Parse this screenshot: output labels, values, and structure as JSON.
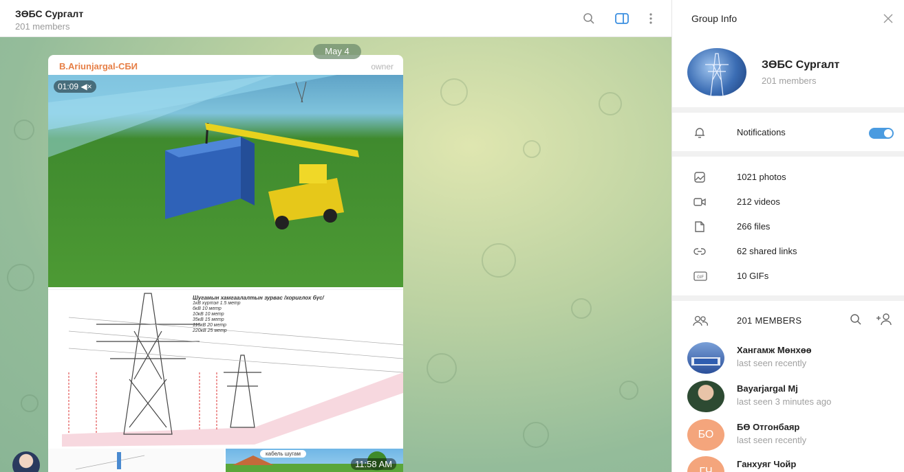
{
  "chat": {
    "title": "ЗӨБС Сургалт",
    "subtitle": "201 members",
    "date_label": "May 4",
    "message": {
      "author": "B.Ariunjargal-СБИ",
      "role": "owner",
      "video_duration": "01:09",
      "tower_title": "Шугамын хамгаалалтын зурвас /хориглох бүс/",
      "tower_lines": [
        "1кВ хүртэл 1.5 метр",
        "6кВ 10 метр",
        "10кВ 10 метр",
        "35кВ 15 метр",
        "110кВ 20 метр",
        "220кВ 25 метр"
      ],
      "diagram_label": "кабель шугам",
      "time": "11:58 AM"
    }
  },
  "panel": {
    "title": "Group Info",
    "group_name": "ЗӨБС Сургалт",
    "group_members": "201 members",
    "notifications_label": "Notifications",
    "notifications_on": true,
    "media": [
      {
        "icon": "photo-icon",
        "label": "1021 photos"
      },
      {
        "icon": "video-icon",
        "label": "212 videos"
      },
      {
        "icon": "file-icon",
        "label": "266 files"
      },
      {
        "icon": "link-icon",
        "label": "62 shared links"
      },
      {
        "icon": "gif-icon",
        "label": "10 GIFs"
      }
    ],
    "members_header": "201 MEMBERS",
    "members": [
      {
        "name": "Хангамж Мөнхөө",
        "status": "last seen recently",
        "initials": ""
      },
      {
        "name": "Bayarjargal Mj",
        "status": "last seen 3 minutes ago",
        "initials": ""
      },
      {
        "name": "БӨ Отгонбаяр",
        "status": "last seen recently",
        "initials": "БО"
      },
      {
        "name": "Ганхуяг Чойр",
        "status": "",
        "initials": "ГЧ"
      }
    ]
  },
  "colors": {
    "accent": "#4a9be0",
    "author": "#e67e45",
    "avatar_orange": "#f4a57c"
  }
}
